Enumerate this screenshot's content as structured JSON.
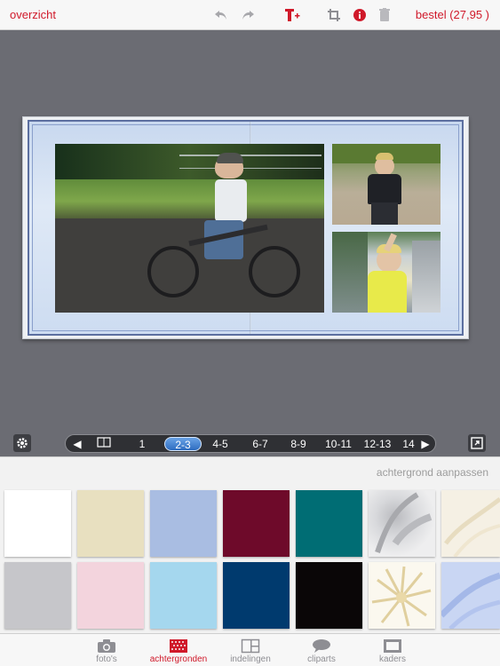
{
  "topbar": {
    "back_label": "overzicht",
    "order_label": "bestel (27,95 )"
  },
  "icons": {
    "undo": "undo-icon",
    "redo": "redo-icon",
    "add_text": "T+",
    "crop": "crop-icon",
    "info": "i",
    "delete": "trash-icon",
    "settings": "gear-icon",
    "fullscreen": "expand-icon"
  },
  "pager": {
    "pages": [
      "1",
      "2-3",
      "4-5",
      "6-7",
      "8-9",
      "10-11",
      "12-13",
      "14"
    ],
    "active_page": "2-3"
  },
  "panel": {
    "adjust_label": "achtergrond aanpassen",
    "swatches_row1": [
      "#ffffff",
      "#e8e0c0",
      "#a9bde2",
      "#6e0a2a",
      "#006d74",
      "pattern-grey-leaf",
      "pattern-cream-floral"
    ],
    "swatches_row2": [
      "#c6c6ca",
      "#f3d4dd",
      "#a5d7ee",
      "#003a6e",
      "#0a0607",
      "pattern-cream-flower",
      "pattern-blue-feather"
    ]
  },
  "tabs": [
    {
      "label": "foto's",
      "icon": "camera-icon"
    },
    {
      "label": "achtergronden",
      "icon": "pattern-icon"
    },
    {
      "label": "indelingen",
      "icon": "layout-icon"
    },
    {
      "label": "cliparts",
      "icon": "speech-bubble-icon"
    },
    {
      "label": "kaders",
      "icon": "frame-icon"
    }
  ],
  "colors": {
    "accent": "#d0192a",
    "active_page": "#2e6cc0"
  }
}
